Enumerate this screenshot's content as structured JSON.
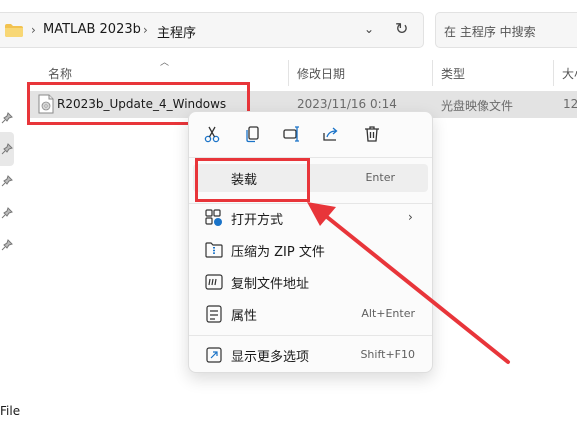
{
  "breadcrumb": {
    "items": [
      "MATLAB 2023b",
      "主程序"
    ],
    "separator": "›",
    "chevron": "chevron-down-icon",
    "refresh": "refresh-icon"
  },
  "search": {
    "placeholder": "在 主程序 中搜索"
  },
  "columns": {
    "name": "名称",
    "date": "修改日期",
    "type": "类型",
    "size": "大小"
  },
  "file": {
    "name": "R2023b_Update_4_Windows",
    "date": "2023/11/16 0:14",
    "type": "光盘映像文件",
    "size": "12"
  },
  "left_pane": {
    "partial_label": "File"
  },
  "context_menu": {
    "toolbar_icons": [
      "cut-icon",
      "copy-icon",
      "rename-icon",
      "share-icon",
      "delete-icon"
    ],
    "items": [
      {
        "label": "装载",
        "shortcut": "Enter",
        "icon": ""
      },
      {
        "label": "打开方式",
        "shortcut": "",
        "icon": "open-with-icon",
        "submenu": true
      },
      {
        "label": "压缩为 ZIP 文件",
        "shortcut": "",
        "icon": "zip-icon"
      },
      {
        "label": "复制文件地址",
        "shortcut": "",
        "icon": "copy-path-icon"
      },
      {
        "label": "属性",
        "shortcut": "Alt+Enter",
        "icon": "properties-icon"
      },
      {
        "label": "显示更多选项",
        "shortcut": "Shift+F10",
        "icon": "more-options-icon"
      }
    ]
  },
  "colors": {
    "annotation": "#e8353a",
    "selection": "#e3e3e3",
    "accent": "#1a73c8"
  }
}
